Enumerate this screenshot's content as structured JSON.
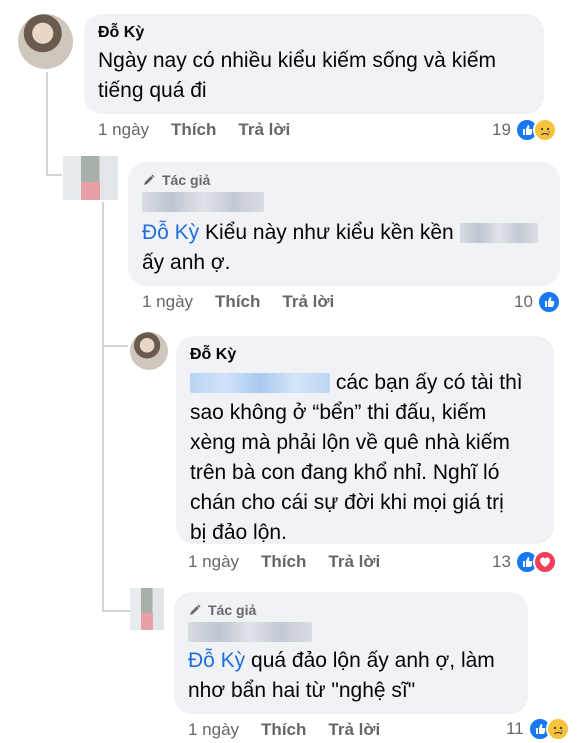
{
  "comments": [
    {
      "author": "Đỗ Kỳ",
      "text_lines": [
        "Ngày nay có nhiều kiểu kiếm sống và kiếm",
        "tiếng quá đi"
      ],
      "time": "1 ngày",
      "like_label": "Thích",
      "reply_label": "Trả lời",
      "reaction_count": "19",
      "reactions": [
        "like-icon",
        "sad-icon"
      ]
    },
    {
      "badge": "Tác giả",
      "tag": "Đỗ Kỳ",
      "text_line1": " Kiểu này như kiểu kền kền",
      "text_line2": "ấy anh ợ.",
      "time": "1 ngày",
      "like_label": "Thích",
      "reply_label": "Trả lời",
      "reaction_count": "10",
      "reactions": [
        "like-icon"
      ]
    },
    {
      "author": "Đỗ Kỳ",
      "text_line1": "các bạn ấy có tài thì",
      "text_lines_rest": [
        "sao không ở “bển” thi đấu, kiếm",
        "xèng mà phải lộn về quê nhà kiếm",
        "trên bà con đang khổ nhỉ. Nghĩ ló",
        "chán cho cái sự đời khi mọi giá trị",
        "bị đảo lộn."
      ],
      "time": "1 ngày",
      "like_label": "Thích",
      "reply_label": "Trả lời",
      "reaction_count": "13",
      "reactions": [
        "like-icon",
        "heart-icon"
      ]
    },
    {
      "badge": "Tác giả",
      "tag": "Đỗ Kỳ",
      "text_line1": " quá đảo lộn ấy anh ợ, làm",
      "text_line2": "nhơ bẩn hai từ \"nghệ sĩ\"",
      "time": "1 ngày",
      "like_label": "Thích",
      "reply_label": "Trả lời",
      "reaction_count": "11",
      "reactions": [
        "like-icon",
        "sad-icon"
      ]
    }
  ]
}
